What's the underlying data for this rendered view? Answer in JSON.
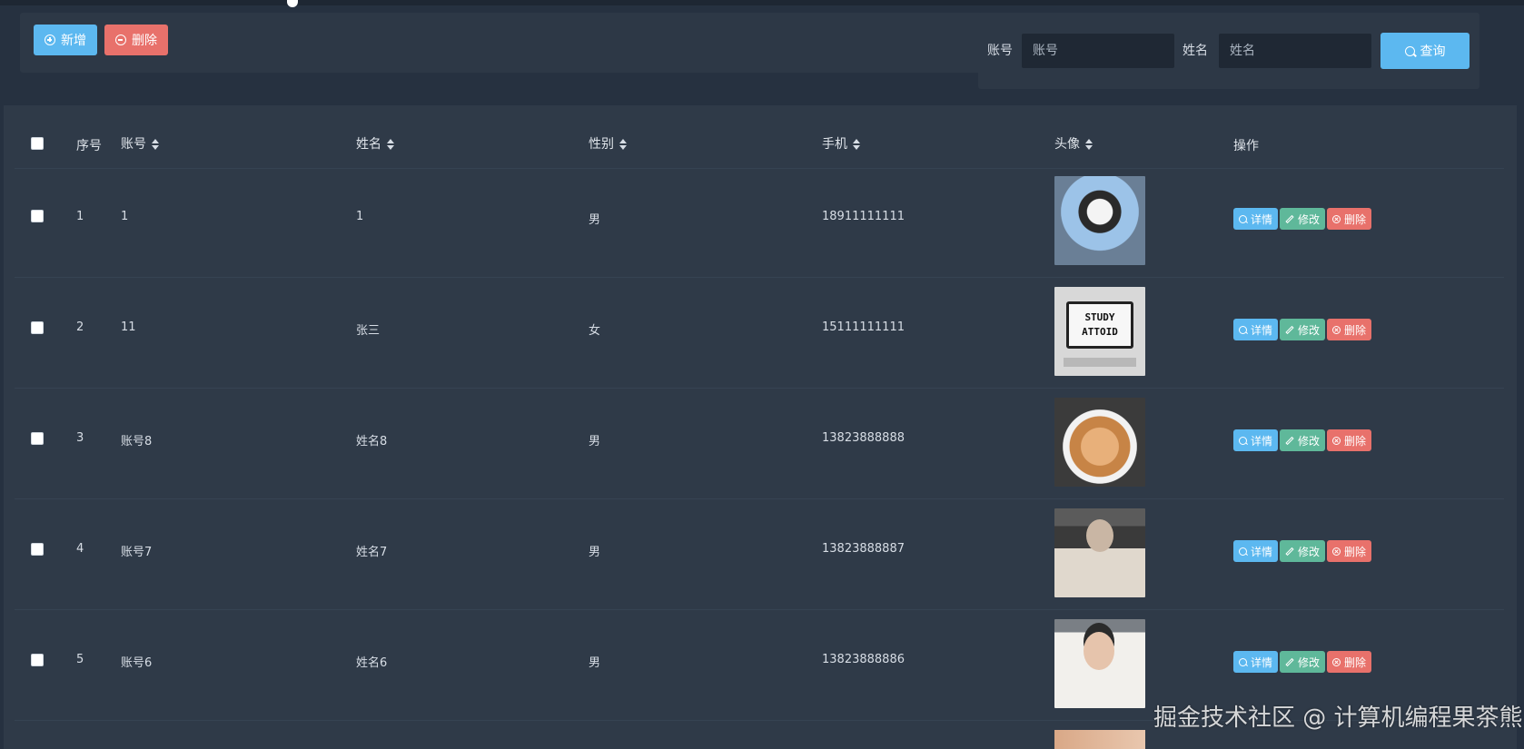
{
  "toolbar": {
    "add_label": "新增",
    "delete_label": "删除"
  },
  "search": {
    "account_label": "账号",
    "account_placeholder": "账号",
    "name_label": "姓名",
    "name_placeholder": "姓名",
    "query_label": "查询"
  },
  "table": {
    "headers": {
      "index": "序号",
      "account": "账号",
      "name": "姓名",
      "gender": "性别",
      "phone": "手机",
      "avatar": "头像",
      "ops": "操作"
    },
    "rows": [
      {
        "index": "1",
        "account": "1",
        "name": "1",
        "gender": "男",
        "phone": "18911111111",
        "avatar": "cat-hat-photo"
      },
      {
        "index": "2",
        "account": "11",
        "name": "张三",
        "gender": "女",
        "phone": "15111111111",
        "avatar": "study-screen-photo"
      },
      {
        "index": "3",
        "account": "账号8",
        "name": "姓名8",
        "gender": "男",
        "phone": "13823888888",
        "avatar": "cat-photo"
      },
      {
        "index": "4",
        "account": "账号7",
        "name": "姓名7",
        "gender": "男",
        "phone": "13823888887",
        "avatar": "man-portrait"
      },
      {
        "index": "5",
        "account": "账号6",
        "name": "姓名6",
        "gender": "男",
        "phone": "13823888886",
        "avatar": "man-portrait"
      }
    ],
    "ops": {
      "detail": "详情",
      "edit": "修改",
      "delete": "删除"
    }
  },
  "avatar_text": {
    "study_line1": "STUDY",
    "study_line2": "ATTOID"
  },
  "watermark": "掘金技术社区 @ 计算机编程果茶熊",
  "colors": {
    "primary": "#5cb8f0",
    "danger": "#e8716b",
    "success": "#5fb89a",
    "background": "#263140"
  }
}
